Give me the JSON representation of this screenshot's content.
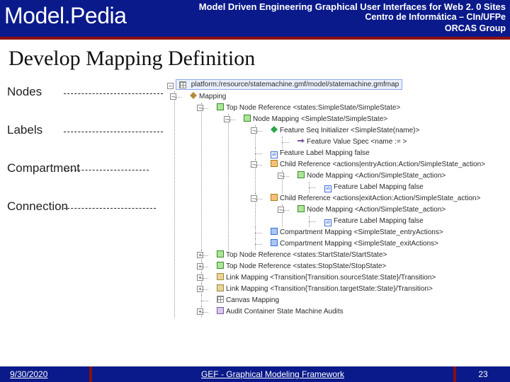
{
  "header": {
    "brand": "Model.Pedia",
    "title": "Model Driven Engineering Graphical User Interfaces for Web 2. 0 Sites",
    "sub1": "Centro de Informática – CIn/UFPe",
    "sub2": "ORCAS Group"
  },
  "page_title": "Develop Mapping Definition",
  "concepts": {
    "nodes": "Nodes",
    "labels": "Labels",
    "compartment": "Compartment",
    "connection": "Connection"
  },
  "tree": {
    "root": "platform:/resource/statemachine.gmf/model/statemachine.gmfmap",
    "mapping": "Mapping",
    "n0": "Top Node Reference <states:SimpleState/SimpleState>",
    "n0m": "Node Mapping <SimpleState/SimpleState>",
    "n0f": "Feature Seq Initializer <SimpleState(name)>",
    "n0fv": "Feature Value Spec <name := >",
    "n0l": "Feature Label Mapping false",
    "n0c1": "Child Reference <actions|entryAction:Action/SimpleState_action>",
    "n0c1m": "Node Mapping <Action/SimpleState_action>",
    "n0c1l": "Feature Label Mapping false",
    "n0c2": "Child Reference <actions|exitAction:Action/SimpleState_action>",
    "n0c2m": "Node Mapping <Action/SimpleState_action>",
    "n0c2l": "Feature Label Mapping false",
    "n0cp1": "Compartment Mapping <SimpleState_entryActions>",
    "n0cp2": "Compartment Mapping <SimpleState_exitActions>",
    "n1": "Top Node Reference <states:StartState/StartState>",
    "n2": "Top Node Reference <states:StopState/StopState>",
    "l1": "Link Mapping <Transition{Transition.sourceState:State}/Transition>",
    "l2": "Link Mapping <Transition{Transition.targetState:State}/Transition>",
    "canvas": "Canvas Mapping",
    "audit": "Audit Container State Machine Audits"
  },
  "footer": {
    "date": "9/30/2020",
    "mid": "GEF - Graphical Modeling Framework",
    "page": "23"
  }
}
